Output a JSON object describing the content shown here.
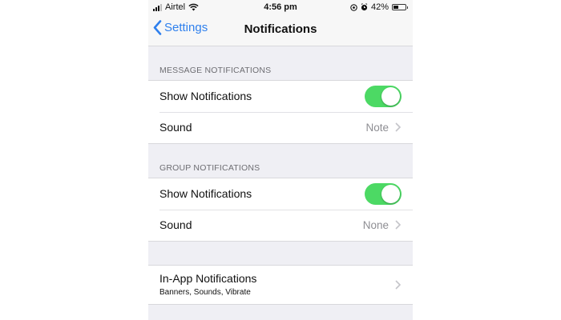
{
  "status_bar": {
    "carrier": "Airtel",
    "time": "4:56 pm",
    "battery": "42%",
    "battery_level": 0.42
  },
  "nav": {
    "back_label": "Settings",
    "title": "Notifications"
  },
  "message_section": {
    "header": "MESSAGE NOTIFICATIONS",
    "show_label": "Show Notifications",
    "show_enabled": true,
    "sound_label": "Sound",
    "sound_value": "Note"
  },
  "group_section": {
    "header": "GROUP NOTIFICATIONS",
    "show_label": "Show Notifications",
    "show_enabled": true,
    "sound_label": "Sound",
    "sound_value": "None"
  },
  "in_app": {
    "label": "In-App Notifications",
    "subtitle": "Banners, Sounds, Vibrate"
  },
  "colors": {
    "accent": "#2f80ed",
    "toggle_on": "#4cd964",
    "background": "#efeff4"
  },
  "icons": [
    "signal-icon",
    "wifi-icon",
    "location-icon",
    "alarm-icon",
    "battery-icon",
    "back-chevron-icon",
    "chevron-right-icon"
  ]
}
